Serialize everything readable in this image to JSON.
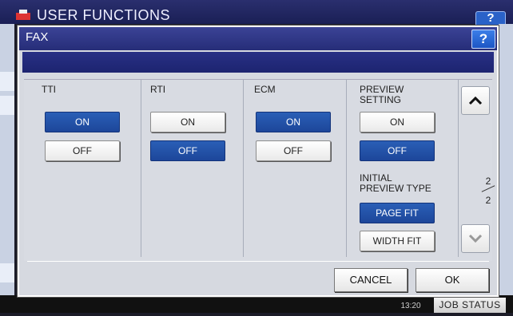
{
  "background": {
    "title": "USER FUNCTIONS",
    "help_label": "?",
    "clock": "13:20",
    "job_status_label": "JOB STATUS"
  },
  "dialog": {
    "title": "FAX",
    "help_label": "?"
  },
  "columns": [
    {
      "label": "TTI",
      "on_label": "ON",
      "off_label": "OFF",
      "selected": "ON"
    },
    {
      "label": "RTI",
      "on_label": "ON",
      "off_label": "OFF",
      "selected": "OFF"
    },
    {
      "label": "ECM",
      "on_label": "ON",
      "off_label": "OFF",
      "selected": "ON"
    },
    {
      "label_line1": "PREVIEW",
      "label_line2": "SETTING",
      "on_label": "ON",
      "off_label": "OFF",
      "selected": "OFF"
    }
  ],
  "initial_preview": {
    "label_line1": "INITIAL",
    "label_line2": "PREVIEW TYPE",
    "options": [
      "PAGE FIT",
      "WIDTH FIT"
    ],
    "selected": "PAGE FIT"
  },
  "pagination": {
    "current": "2",
    "total": "2"
  },
  "footer": {
    "cancel_label": "CANCEL",
    "ok_label": "OK"
  },
  "colors": {
    "selected": "#2553a8",
    "title_bar": "#2c3385"
  }
}
